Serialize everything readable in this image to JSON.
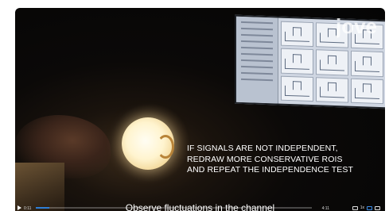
{
  "logo": {
    "text": "jove"
  },
  "overlay": {
    "lines": [
      "IF SIGNALS ARE NOT INDEPENDENT,",
      "REDRAW MORE CONSERVATIVE ROIS",
      "AND REPEAT THE INDEPENDENCE TEST"
    ]
  },
  "subtitle": {
    "text": "Observe fluctuations in the channel"
  },
  "player": {
    "time_elapsed": "0:11",
    "time_total": "4:11",
    "speed": "1x",
    "progress": 0.05,
    "accent_color": "#2f7fd6"
  },
  "icons": {
    "play": "play-icon",
    "volume": "volume-icon",
    "speed": "speed-icon",
    "captions": "captions-icon",
    "fullscreen": "fullscreen-icon"
  }
}
